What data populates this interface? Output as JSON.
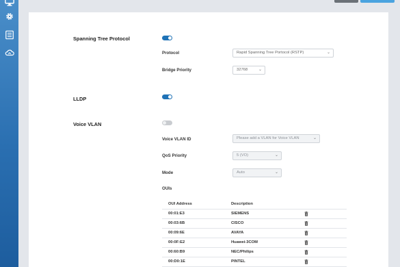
{
  "sidebar": {
    "items": [
      {
        "icon": "monitor-icon"
      },
      {
        "icon": "gear-icon"
      },
      {
        "icon": "list-icon"
      },
      {
        "icon": "cloud-icon"
      }
    ]
  },
  "stp": {
    "label": "Spanning Tree Protocol",
    "enabled": true,
    "protocol_label": "Protocol",
    "protocol_value": "Rapid Spanning Tree Portocol (RSTP)",
    "bridge_priority_label": "Bridge Priority",
    "bridge_priority_value": "32768"
  },
  "lldp": {
    "label": "LLDP",
    "enabled": true
  },
  "voice_vlan": {
    "label": "Voice VLAN",
    "enabled": false,
    "vlan_id_label": "Voice VLAN ID",
    "vlan_id_value": "Please add a VLAN for Voice VLAN",
    "qos_label": "QoS Priority",
    "qos_value": "5 (VO)",
    "mode_label": "Mode",
    "mode_value": "Auto",
    "ouis_label": "OUIs"
  },
  "oui_table": {
    "headers": [
      "OUI Address",
      "Description"
    ],
    "rows": [
      {
        "address": "00:01:E3",
        "description": "SIEMENS"
      },
      {
        "address": "00:03:6B",
        "description": "CISCO"
      },
      {
        "address": "00:09:6E",
        "description": "AVAYA"
      },
      {
        "address": "00:0F:E2",
        "description": "Huawei-3COM"
      },
      {
        "address": "00:60:B9",
        "description": "NEC/Philips"
      },
      {
        "address": "00:D0:1E",
        "description": "PINTEL"
      }
    ]
  },
  "colors": {
    "accent": "#1f73b7",
    "toggle_off": "#c9ccd0",
    "sidebar_top": "#4a8ec9",
    "sidebar_bottom": "#1d5d9e",
    "cancel_button": "#6b7177",
    "save_button": "#4aa3df"
  }
}
